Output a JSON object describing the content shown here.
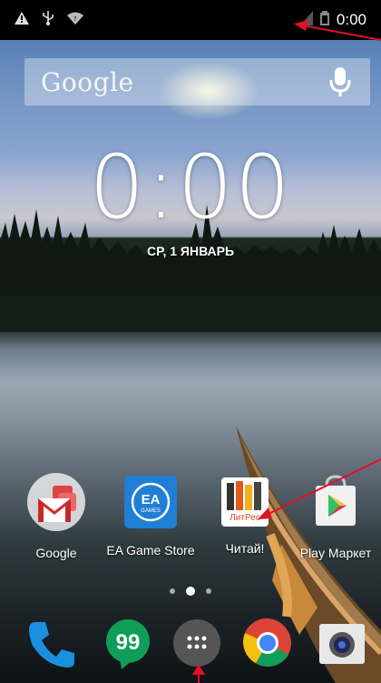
{
  "status_bar": {
    "left_icons": [
      "warning-icon",
      "usb-icon",
      "wifi-icon"
    ],
    "right_icons": [
      "signal-icon",
      "battery-icon"
    ],
    "time": "0:00"
  },
  "search": {
    "logo": "Google",
    "mic_icon": "mic-icon"
  },
  "clock": {
    "time": "0:00",
    "date": "СР, 1 ЯНВАРЬ"
  },
  "apps": [
    {
      "label": "Google",
      "icon": "google-folder-icon"
    },
    {
      "label": "EA Game Store",
      "icon": "ea-games-icon",
      "icon_text": "EA",
      "icon_subtext": "GAMES"
    },
    {
      "label": "Читай!",
      "icon": "litres-icon",
      "icon_text": "ЛитРес"
    },
    {
      "label": "Play Маркет",
      "icon": "play-store-icon"
    }
  ],
  "page_indicator": {
    "count": 3,
    "active": 1
  },
  "dock": [
    {
      "name": "phone",
      "icon": "phone-icon"
    },
    {
      "name": "hangouts",
      "icon": "hangouts-icon",
      "icon_text": "99"
    },
    {
      "name": "all-apps",
      "icon": "app-drawer-icon"
    },
    {
      "name": "chrome",
      "icon": "chrome-icon"
    },
    {
      "name": "camera",
      "icon": "camera-icon"
    }
  ],
  "colors": {
    "annotation_red": "#e0102a",
    "ea_blue": "#1e7fd4",
    "hangouts_green": "#0f9d58",
    "phone_blue": "#1a8fe0"
  }
}
